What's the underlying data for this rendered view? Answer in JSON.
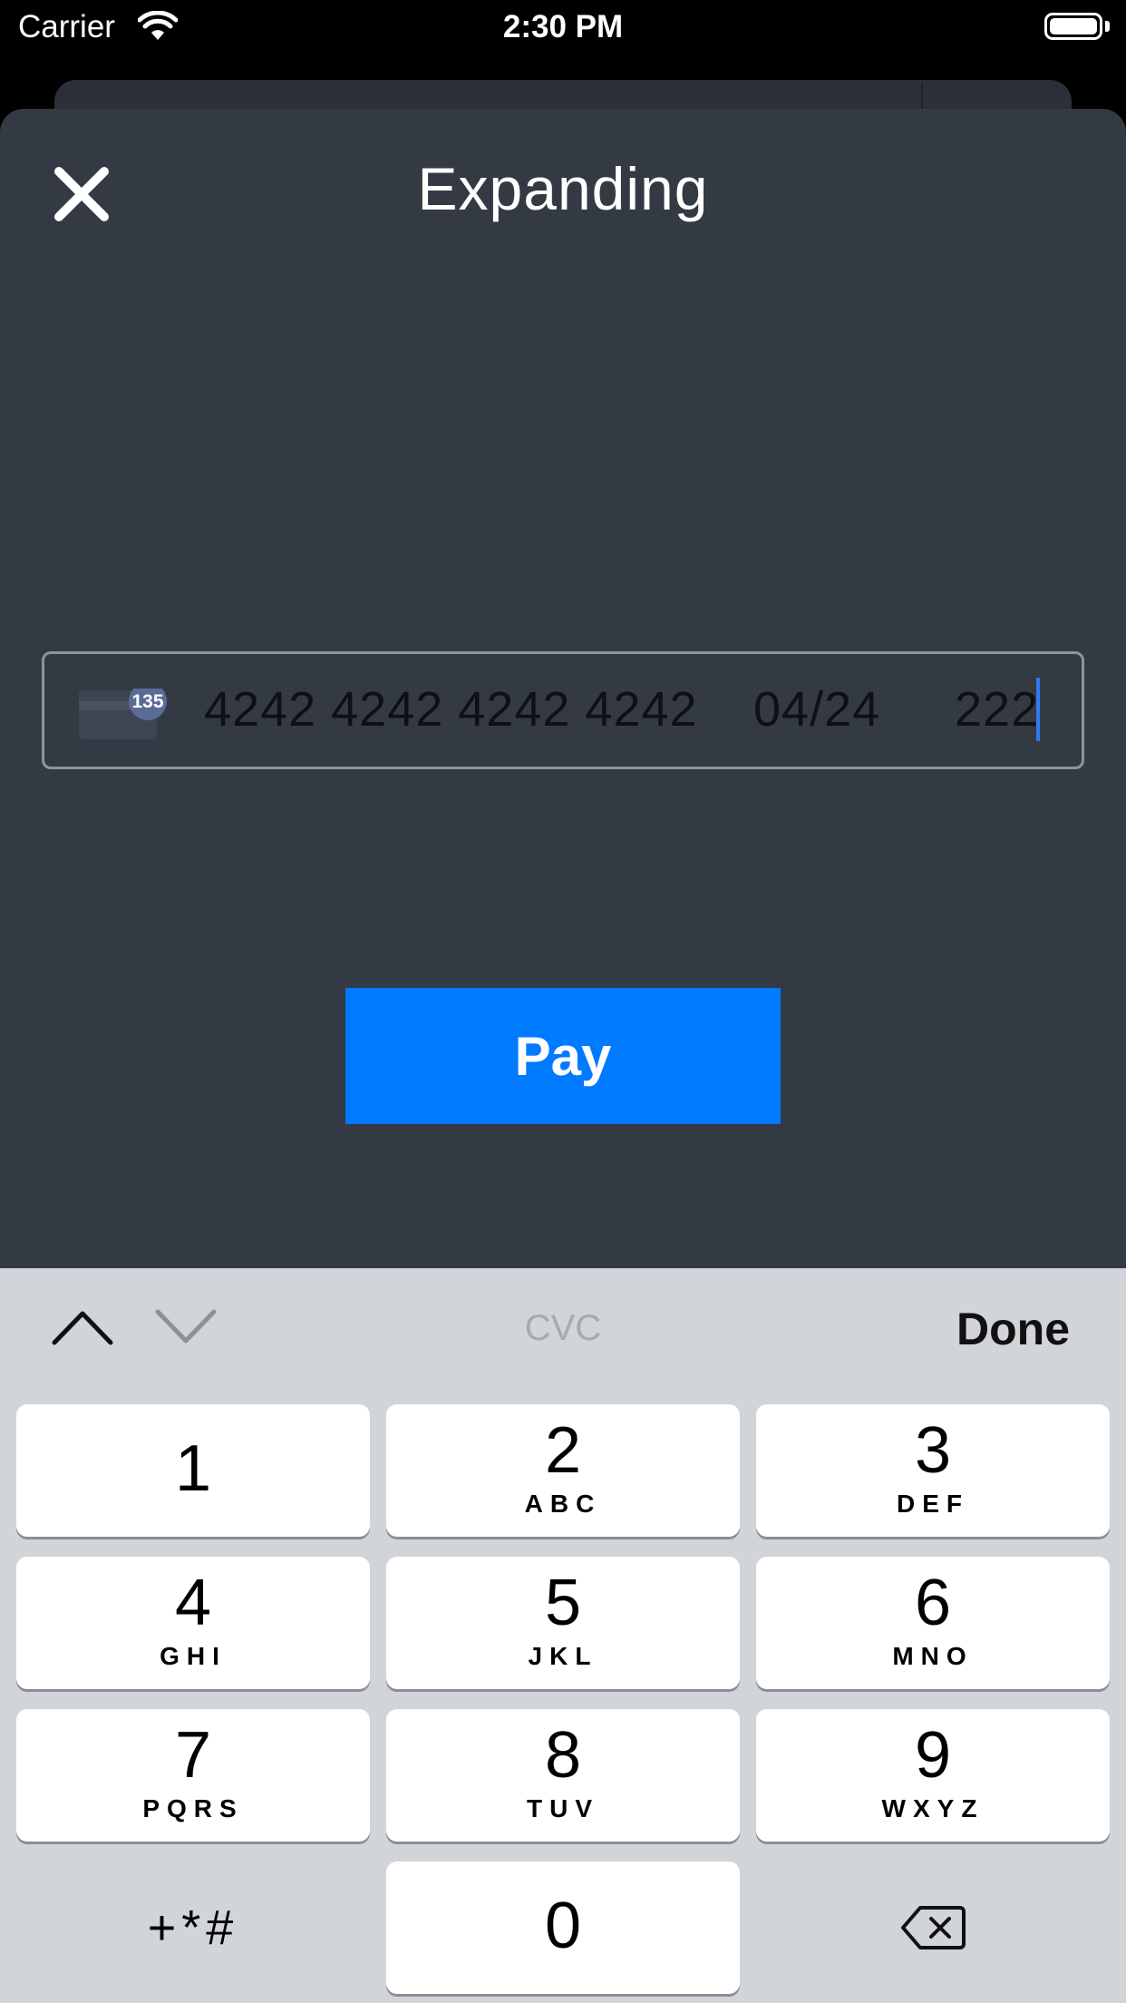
{
  "status_bar": {
    "carrier": "Carrier",
    "time": "2:30 PM"
  },
  "sheet": {
    "title": "Expanding"
  },
  "card_field": {
    "number": "4242 4242 4242 4242",
    "expiry": "04/24",
    "cvc": "222",
    "card_icon_badge": "135"
  },
  "pay_button": {
    "label": "Pay",
    "color": "#007aff"
  },
  "keyboard": {
    "field_hint": "CVC",
    "done_label": "Done",
    "keys": [
      {
        "digit": "1",
        "letters": ""
      },
      {
        "digit": "2",
        "letters": "ABC"
      },
      {
        "digit": "3",
        "letters": "DEF"
      },
      {
        "digit": "4",
        "letters": "GHI"
      },
      {
        "digit": "5",
        "letters": "JKL"
      },
      {
        "digit": "6",
        "letters": "MNO"
      },
      {
        "digit": "7",
        "letters": "PQRS"
      },
      {
        "digit": "8",
        "letters": "TUV"
      },
      {
        "digit": "9",
        "letters": "WXYZ"
      },
      {
        "digit": "0",
        "letters": ""
      }
    ],
    "symbols_label": "+*#"
  }
}
